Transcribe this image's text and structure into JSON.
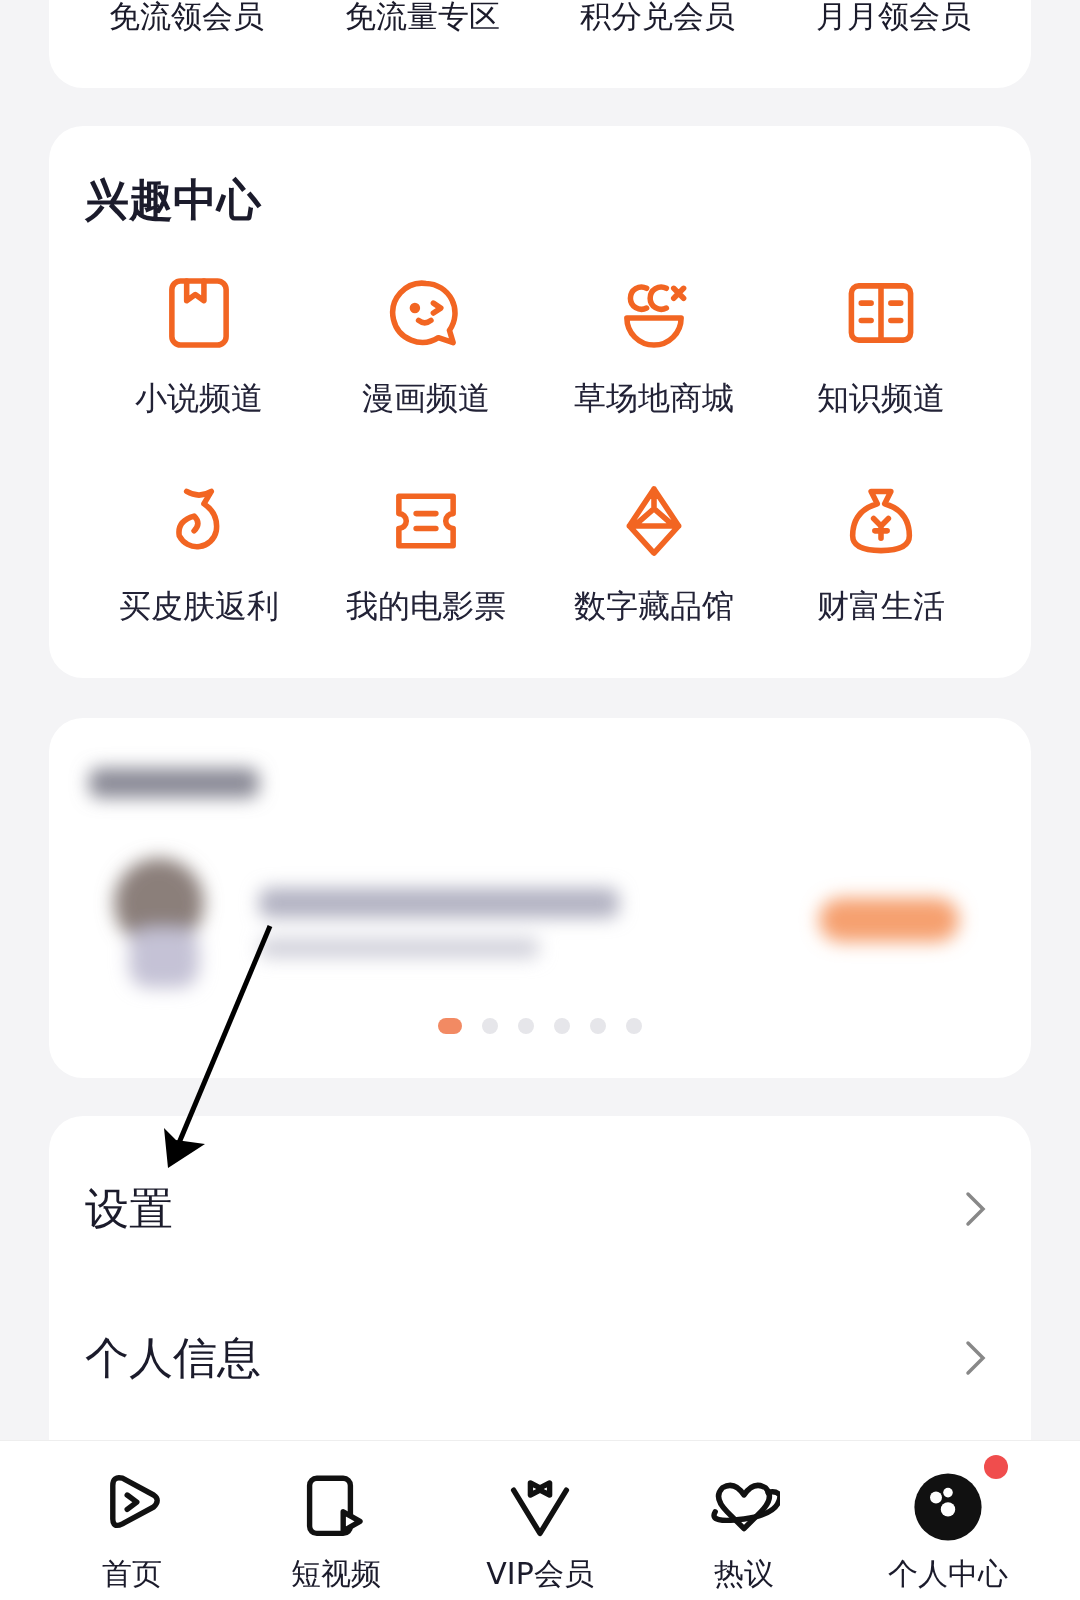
{
  "top_links": [
    "免流领会员",
    "免流量专区",
    "积分兑会员",
    "月月领会员"
  ],
  "interest_center": {
    "title": "兴趣中心",
    "items": [
      {
        "label": "小说频道"
      },
      {
        "label": "漫画频道"
      },
      {
        "label": "草场地商城"
      },
      {
        "label": "知识频道"
      },
      {
        "label": "买皮肤返利"
      },
      {
        "label": "我的电影票"
      },
      {
        "label": "数字藏品馆"
      },
      {
        "label": "财富生活"
      }
    ]
  },
  "banner": {
    "pages": [
      {
        "selected": true
      },
      {
        "selected": false
      },
      {
        "selected": false
      },
      {
        "selected": false
      },
      {
        "selected": false
      },
      {
        "selected": false
      }
    ]
  },
  "menu": [
    {
      "label": "设置"
    },
    {
      "label": "个人信息"
    }
  ],
  "tab_bar": [
    {
      "label": "首页",
      "badge": false
    },
    {
      "label": "短视频",
      "badge": false
    },
    {
      "label": "VIP会员",
      "badge": false
    },
    {
      "label": "热议",
      "badge": false
    },
    {
      "label": "个人中心",
      "badge": true
    }
  ]
}
